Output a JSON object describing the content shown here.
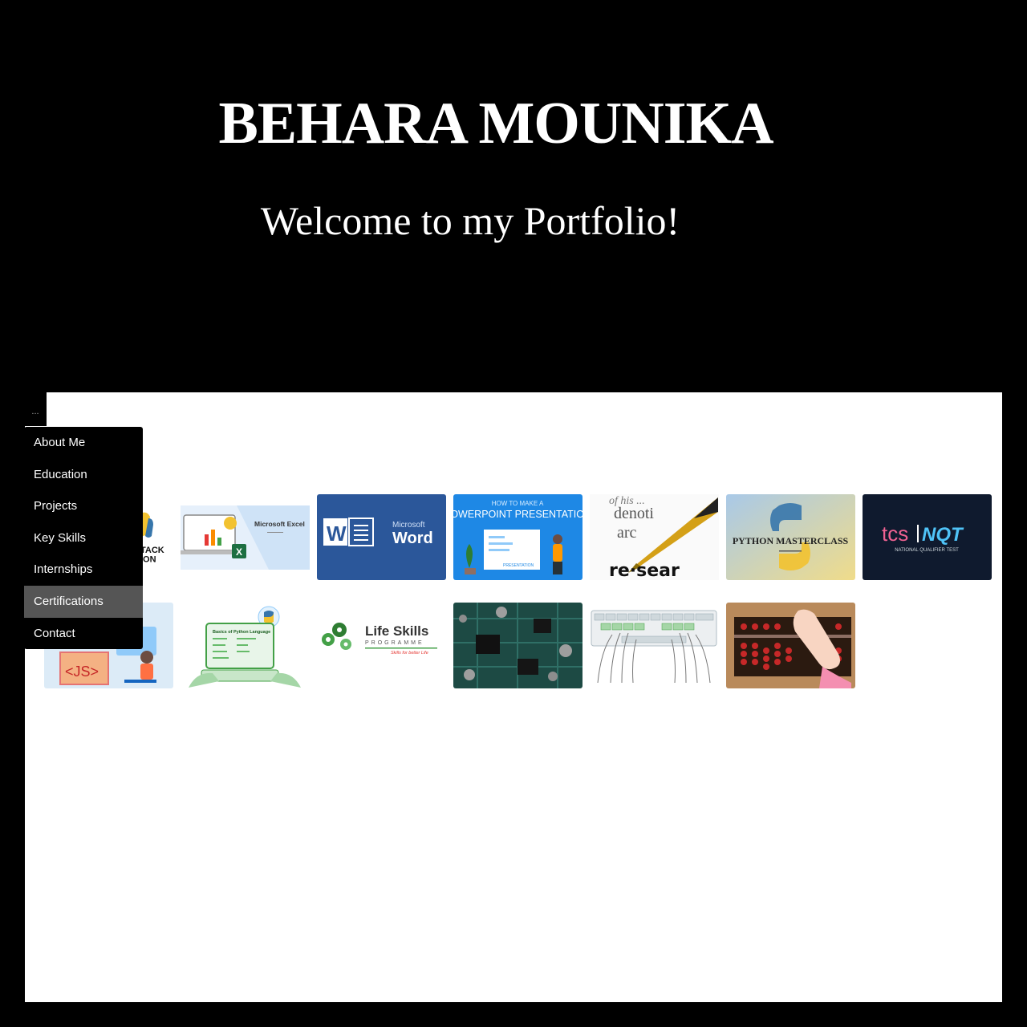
{
  "header": {
    "name": "BEHARA MOUNIKA",
    "welcome": "Welcome to my Portfolio!"
  },
  "menu": {
    "toggle_label": "...",
    "items": [
      {
        "label": "About Me"
      },
      {
        "label": "Education"
      },
      {
        "label": "Projects"
      },
      {
        "label": "Key Skills"
      },
      {
        "label": "Internships"
      },
      {
        "label": "Certifications",
        "active": true
      },
      {
        "label": "Contact"
      }
    ]
  },
  "certificates": {
    "full_stack": {
      "text": "TACK\nION"
    },
    "excel": {
      "title": "Microsoft Excel"
    },
    "word": {
      "line1": "Microsoft",
      "line2": "Word",
      "icon_letter": "W"
    },
    "powerpoint": {
      "line1": "HOW TO MAKE A",
      "line2": "POWERPOINT PRESENTATION",
      "inner": "PRESENTATION"
    },
    "research": {
      "line1": "of his ...",
      "line2": "denoti",
      "line3": "arc",
      "line4": "re·sear"
    },
    "python_masterclass": {
      "title": "PYTHON MASTERCLASS"
    },
    "tcs_nqt": {
      "brand": "tcs",
      "brand2": "NQT",
      "subtitle": "NATIONAL QUALIFIER TEST"
    },
    "javascript": {
      "tag": "<JS>"
    },
    "python_language": {
      "title": "Basics of Python Language"
    },
    "life_skills": {
      "line1": "Life Skills",
      "line2": "PROGRAMME",
      "line3": "Skills for better Life"
    }
  },
  "colors": {
    "background": "#000000",
    "panel": "#ffffff",
    "menu_active": "#555555",
    "word_blue": "#2b579a",
    "ppt_blue": "#1e88e5",
    "tcs_navy": "#0f1a2e"
  }
}
